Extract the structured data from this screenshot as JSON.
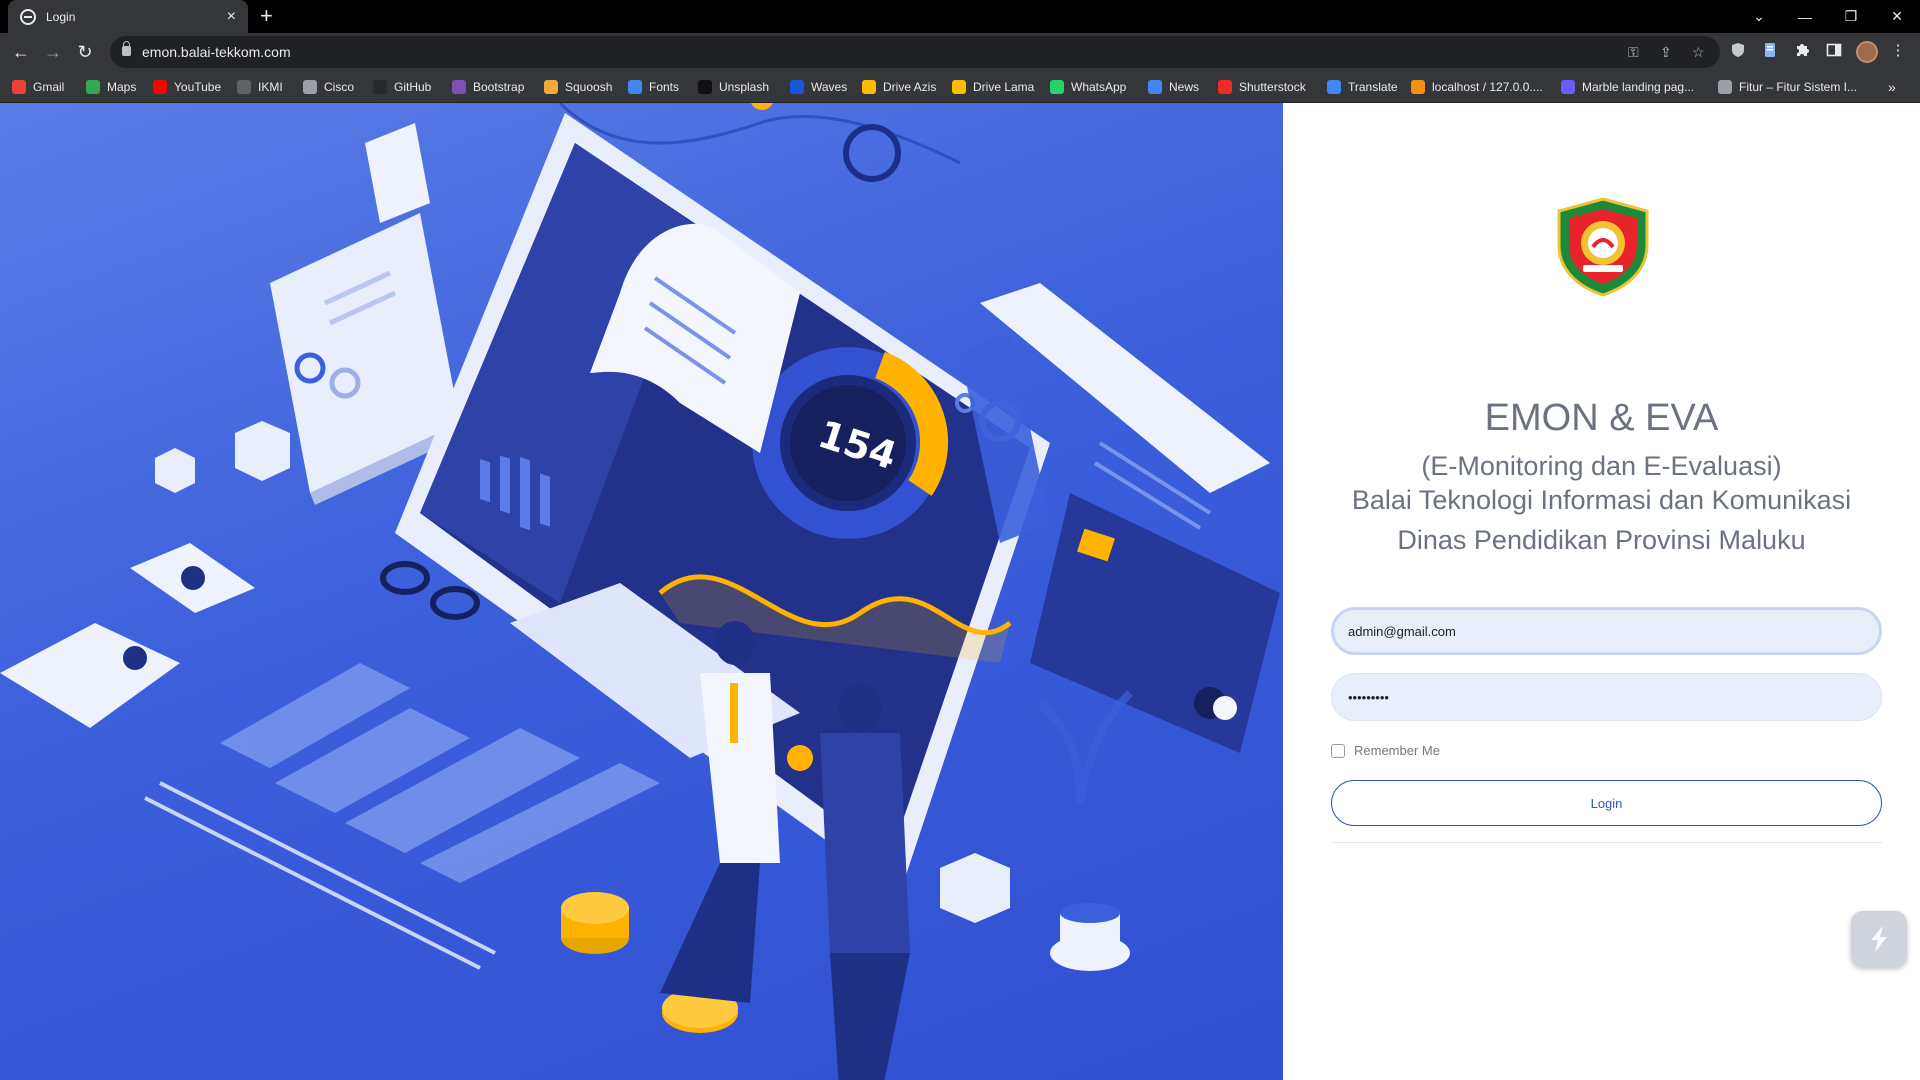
{
  "browser": {
    "tab": {
      "title": "Login",
      "close": "×"
    },
    "new_tab": "+",
    "window_controls": {
      "tabsearch": "⌄",
      "minimize": "—",
      "restore": "❐",
      "close": "✕"
    },
    "nav": {
      "back": "←",
      "forward": "→",
      "reload": "↻"
    },
    "url": "emon.balai-tekkom.com",
    "omnibox_icons": {
      "key": "⚿",
      "share": "⇪",
      "star": "☆"
    },
    "extensions": [
      "shield-icon",
      "document-icon",
      "puzzle-icon",
      "sidepanel-icon"
    ],
    "menu": "⋮",
    "bookmarks": [
      {
        "label": "Gmail",
        "color": "#ea4335"
      },
      {
        "label": "Maps",
        "color": "#34a853"
      },
      {
        "label": "YouTube",
        "color": "#ff0000"
      },
      {
        "label": "IKMI",
        "color": "#5f6368"
      },
      {
        "label": "Cisco",
        "color": "#9aa0a6"
      },
      {
        "label": "GitHub",
        "color": "#24292e"
      },
      {
        "label": "Bootstrap",
        "color": "#7952b3"
      },
      {
        "label": "Squoosh",
        "color": "#f4a73b"
      },
      {
        "label": "Fonts",
        "color": "#4285f4"
      },
      {
        "label": "Unsplash",
        "color": "#111111"
      },
      {
        "label": "Waves",
        "color": "#1a56db"
      },
      {
        "label": "Drive Azis",
        "color": "#fbbc04"
      },
      {
        "label": "Drive Lama",
        "color": "#fbbc04"
      },
      {
        "label": "WhatsApp",
        "color": "#25d366"
      },
      {
        "label": "News",
        "color": "#4285f4"
      },
      {
        "label": "Shutterstock",
        "color": "#ee2b24"
      },
      {
        "label": "Translate",
        "color": "#4285f4"
      },
      {
        "label": "localhost / 127.0.0....",
        "color": "#f29111"
      },
      {
        "label": "Marble landing pag...",
        "color": "#6d5dfc"
      },
      {
        "label": "Fitur – Fitur Sistem I...",
        "color": "#9aa0a6"
      }
    ],
    "bookmarks_overflow": "»"
  },
  "hero": {
    "counter": "154",
    "accent_blue": "#3c5fdc",
    "accent_orange": "#ffb200"
  },
  "login": {
    "title": "EMON & EVA",
    "subtitle_1": "(E-Monitoring dan E-Evaluasi)",
    "subtitle_2": "Balai Teknologi Informasi dan Komunikasi",
    "subtitle_3": "Dinas Pendidikan Provinsi Maluku",
    "email_value": "admin@gmail.com",
    "password_value": "•••••••••",
    "remember_label": "Remember Me",
    "remember_checked": false,
    "button_label": "Login",
    "button_color": "#2f55c4"
  }
}
